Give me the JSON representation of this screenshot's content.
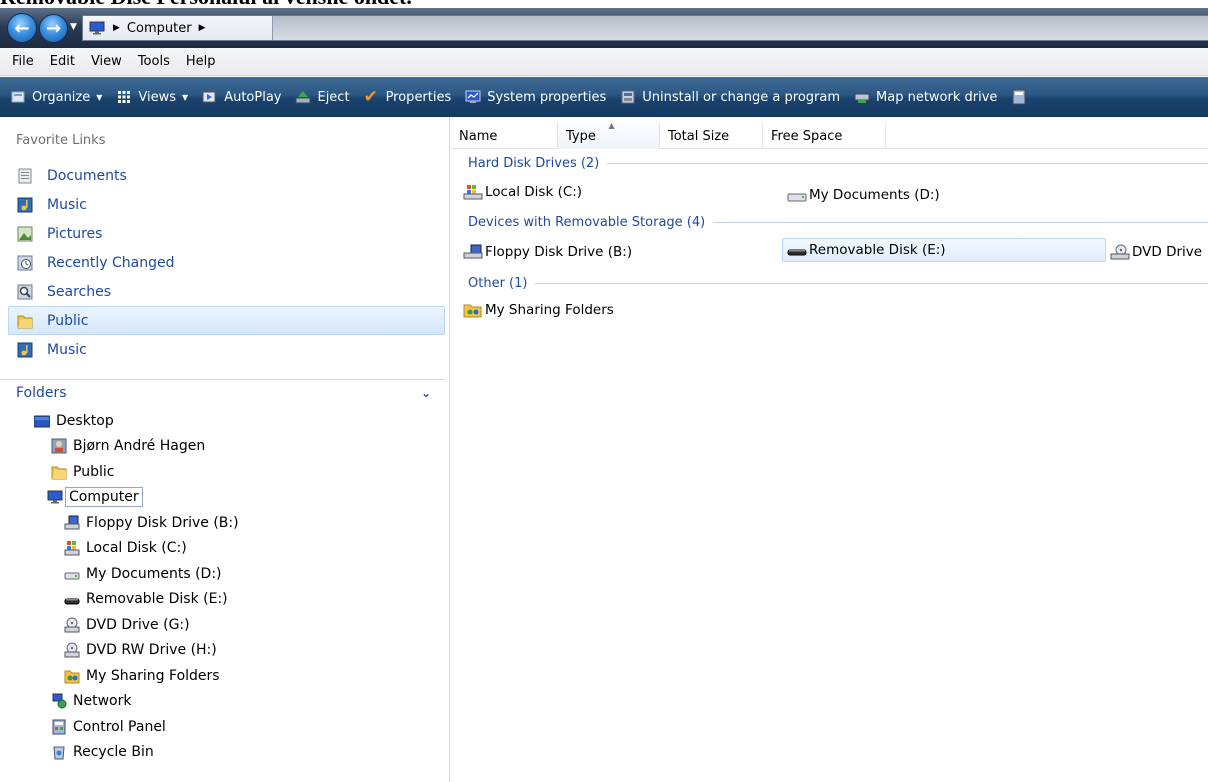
{
  "caption": "Removable Disc Personalul al venshe ondet.",
  "address": {
    "segments": [
      "Computer"
    ]
  },
  "menubar": [
    "File",
    "Edit",
    "View",
    "Tools",
    "Help"
  ],
  "commands": [
    {
      "label": "Organize",
      "icon": "organize-icon",
      "dropdown": true
    },
    {
      "label": "Views",
      "icon": "views-icon",
      "dropdown": true
    },
    {
      "label": "AutoPlay",
      "icon": "autoplay-icon",
      "dropdown": false
    },
    {
      "label": "Eject",
      "icon": "eject-icon",
      "dropdown": false
    },
    {
      "label": "Properties",
      "icon": "properties-check-icon",
      "dropdown": false
    },
    {
      "label": "System properties",
      "icon": "system-properties-icon",
      "dropdown": false
    },
    {
      "label": "Uninstall or change a program",
      "icon": "uninstall-icon",
      "dropdown": false
    },
    {
      "label": "Map network drive",
      "icon": "map-network-drive-icon",
      "dropdown": false
    }
  ],
  "favorites": {
    "header": "Favorite Links",
    "items": [
      {
        "label": "Documents",
        "icon": "documents-icon"
      },
      {
        "label": "Music",
        "icon": "music-icon"
      },
      {
        "label": "Pictures",
        "icon": "pictures-icon"
      },
      {
        "label": "Recently Changed",
        "icon": "recently-changed-icon"
      },
      {
        "label": "Searches",
        "icon": "searches-icon"
      },
      {
        "label": "Public",
        "icon": "public-folder-icon",
        "selected": true
      },
      {
        "label": "Music",
        "icon": "music-icon"
      }
    ]
  },
  "folders": {
    "header": "Folders",
    "tree": [
      {
        "label": "Desktop",
        "icon": "desktop-icon",
        "level": 0
      },
      {
        "label": "Bjørn André Hagen",
        "icon": "user-folder-icon",
        "level": 1
      },
      {
        "label": "Public",
        "icon": "public-folder-icon",
        "level": 1
      },
      {
        "label": "Computer",
        "icon": "computer-icon",
        "level": 1,
        "selected": true
      },
      {
        "label": "Floppy Disk Drive (B:)",
        "icon": "floppy-drive-icon",
        "level": 2
      },
      {
        "label": "Local Disk (C:)",
        "icon": "local-disk-icon",
        "level": 2
      },
      {
        "label": "My Documents (D:)",
        "icon": "hard-drive-icon",
        "level": 2
      },
      {
        "label": "Removable Disk (E:)",
        "icon": "removable-disk-icon",
        "level": 2
      },
      {
        "label": "DVD Drive (G:)",
        "icon": "dvd-drive-icon",
        "level": 2
      },
      {
        "label": "DVD RW Drive (H:)",
        "icon": "dvd-drive-icon",
        "level": 2
      },
      {
        "label": "My Sharing Folders",
        "icon": "sharing-folders-icon",
        "level": 2
      },
      {
        "label": "Network",
        "icon": "network-icon",
        "level": 1
      },
      {
        "label": "Control Panel",
        "icon": "control-panel-icon",
        "level": 1
      },
      {
        "label": "Recycle Bin",
        "icon": "recycle-bin-icon",
        "level": 1
      }
    ]
  },
  "columns": [
    "Name",
    "Type",
    "Total Size",
    "Free Space"
  ],
  "groups": [
    {
      "title": "Hard Disk Drives (2)",
      "items": [
        {
          "label": "Local Disk (C:)",
          "icon": "local-disk-icon"
        },
        {
          "label": "My Documents (D:)",
          "icon": "hard-drive-icon"
        }
      ]
    },
    {
      "title": "Devices with Removable Storage (4)",
      "items": [
        {
          "label": "Floppy Disk Drive (B:)",
          "icon": "floppy-drive-icon"
        },
        {
          "label": "Removable Disk (E:)",
          "icon": "removable-disk-icon",
          "selected": true
        },
        {
          "label": "DVD Drive",
          "icon": "dvd-drive-icon"
        }
      ]
    },
    {
      "title": "Other (1)",
      "items": [
        {
          "label": "My Sharing Folders",
          "icon": "sharing-folders-icon"
        }
      ]
    }
  ]
}
